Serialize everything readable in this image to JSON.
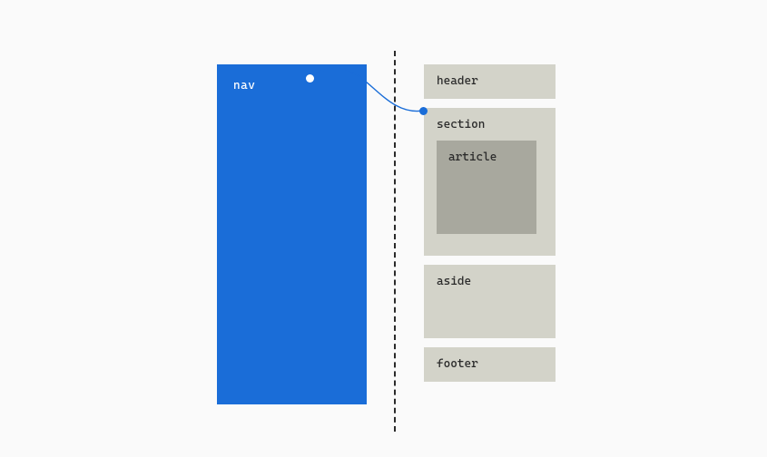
{
  "labels": {
    "nav": "nav",
    "header": "header",
    "section": "section",
    "article": "article",
    "aside": "aside",
    "footer": "footer"
  },
  "colors": {
    "navBackground": "#1a6dd8",
    "blockBackground": "#d3d3c9",
    "articleBackground": "#a8a89e",
    "canvasBackground": "#fafafa"
  }
}
